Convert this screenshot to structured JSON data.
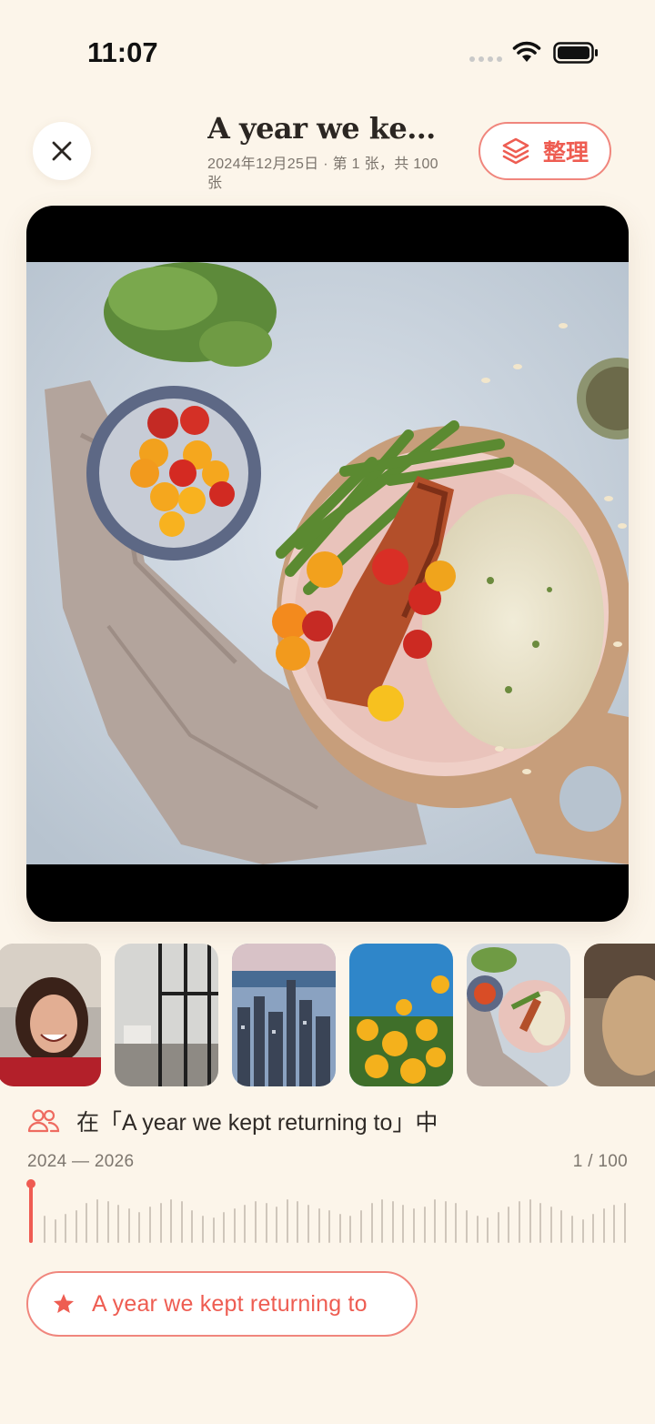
{
  "status_bar": {
    "time": "11:07"
  },
  "header": {
    "title": "A year we kep…",
    "subtitle": "2024年12月25日 · 第 1 张，共 100 张",
    "organize_label": "整理"
  },
  "album_line": {
    "text": "在「A year we kept returning to」中"
  },
  "timeline": {
    "range": "2024 — 2026",
    "position": "1 / 100",
    "current_index": 1,
    "total": 100
  },
  "album_chip": {
    "label": "A year we kept returning to"
  },
  "icons": {
    "close": "close-icon",
    "organize": "layers-icon",
    "album": "people-icon",
    "chip": "star-icon"
  },
  "colors": {
    "background": "#fcf5ea",
    "accent": "#ee5d52",
    "accent_border": "#f0867d",
    "text": "#2b2622",
    "muted": "#7b746c"
  }
}
